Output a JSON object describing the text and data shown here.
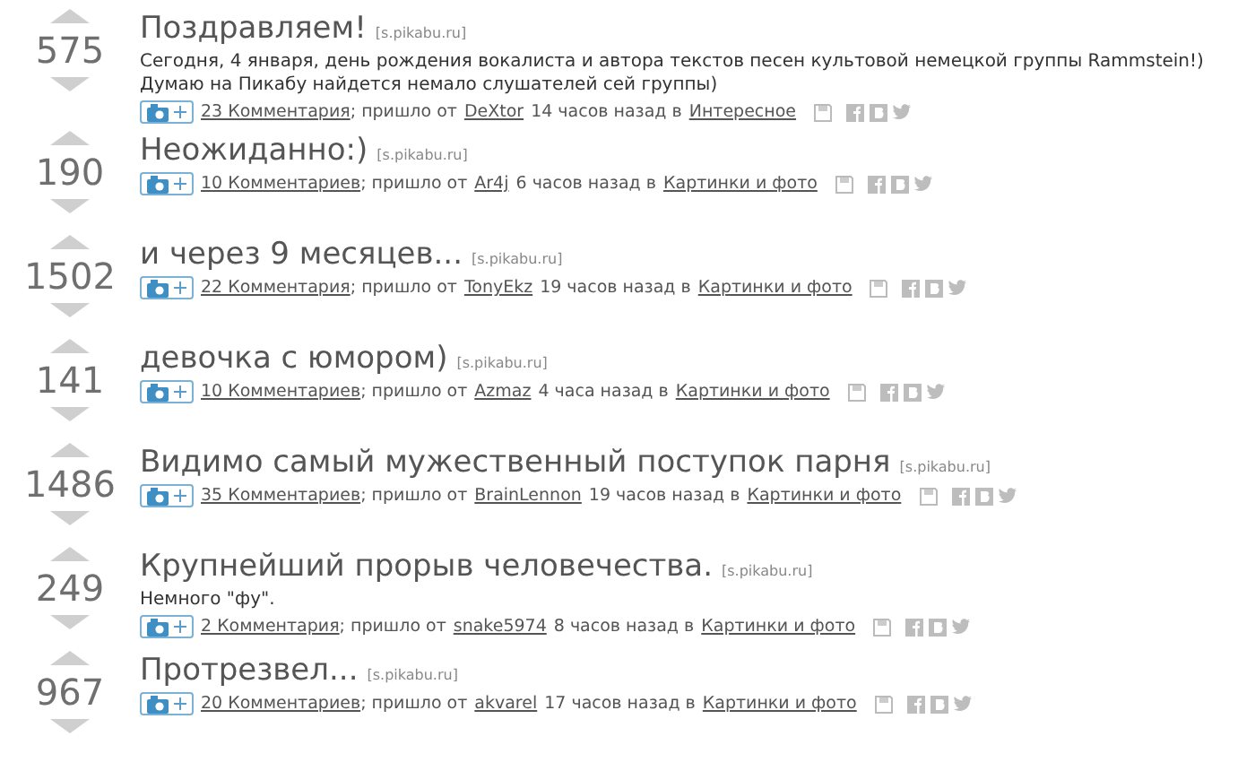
{
  "posts": [
    {
      "score": "575",
      "title": "Поздравляем!",
      "source": "[s.pikabu.ru]",
      "description": "Сегодня, 4 января, день рождения вокалиста и автора текстов песен культовой немецкой группы Rammstein!) Думаю на Пикабу найдется немало слушателей сей группы)",
      "comments": "23 Комментария",
      "from": "; пришло от",
      "author": "DeXtor",
      "time": "14 часов назад в",
      "category": "Интересное"
    },
    {
      "score": "190",
      "title": "Неожиданно:)",
      "source": "[s.pikabu.ru]",
      "comments": "10 Комментариев",
      "from": "; пришло от",
      "author": "Ar4j",
      "time": "6 часов назад в",
      "category": "Картинки и фото"
    },
    {
      "score": "1502",
      "title": "и через 9 месяцев...",
      "source": "[s.pikabu.ru]",
      "comments": "22 Комментария",
      "from": "; пришло от",
      "author": "TonyEkz",
      "time": "19 часов назад в",
      "category": "Картинки и фото"
    },
    {
      "score": "141",
      "title": "девочка с юмором)",
      "source": "[s.pikabu.ru]",
      "comments": "10 Комментариев",
      "from": "; пришло от",
      "author": "Azmaz",
      "time": "4 часа назад в",
      "category": "Картинки и фото"
    },
    {
      "score": "1486",
      "title": "Видимо самый мужественный поступок парня",
      "source": "[s.pikabu.ru]",
      "comments": "35 Комментариев",
      "from": "; пришло от",
      "author": "BrainLennon",
      "time": "19 часов назад в",
      "category": "Картинки и фото"
    },
    {
      "score": "249",
      "title": "Крупнейший прорыв человечества.",
      "source": "[s.pikabu.ru]",
      "description": "Немного \"фу\".",
      "comments": "2 Комментария",
      "from": "; пришло от",
      "author": "snake5974",
      "time": "8 часов назад в",
      "category": "Картинки и фото"
    },
    {
      "score": "967",
      "title": "Протрезвел...",
      "source": "[s.pikabu.ru]",
      "comments": "20 Комментариев",
      "from": "; пришло от",
      "author": "akvarel",
      "time": "17 часов назад в",
      "category": "Картинки и фото"
    }
  ]
}
